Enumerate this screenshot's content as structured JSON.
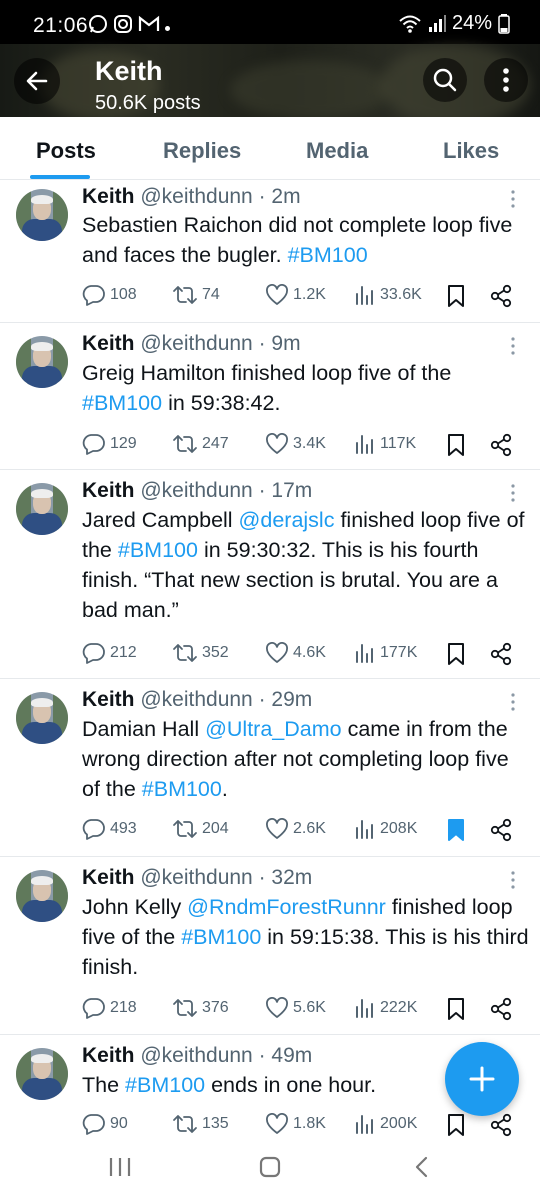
{
  "status_bar": {
    "time": "21:06",
    "battery": "24%"
  },
  "profile": {
    "name": "Keith",
    "post_count": "50.6K posts"
  },
  "tabs": [
    {
      "label": "Posts",
      "active": true
    },
    {
      "label": "Replies",
      "active": false
    },
    {
      "label": "Media",
      "active": false
    },
    {
      "label": "Likes",
      "active": false
    }
  ],
  "tweets": [
    {
      "name": "Keith",
      "handle": "@keithdunn",
      "time": "· 2m",
      "text_parts": [
        {
          "t": "Sebastien Raichon did not complete loop five and faces the bugler. "
        },
        {
          "t": "#BM100",
          "link": true
        }
      ],
      "replies": "108",
      "reposts": "74",
      "likes": "1.2K",
      "views": "33.6K",
      "bookmarked": false
    },
    {
      "name": "Keith",
      "handle": "@keithdunn",
      "time": "· 9m",
      "text_parts": [
        {
          "t": "Greig Hamilton finished loop five of the "
        },
        {
          "t": "#BM100",
          "link": true
        },
        {
          "t": " in 59:38:42."
        }
      ],
      "replies": "129",
      "reposts": "247",
      "likes": "3.4K",
      "views": "117K",
      "bookmarked": false
    },
    {
      "name": "Keith",
      "handle": "@keithdunn",
      "time": "· 17m",
      "text_parts": [
        {
          "t": "Jared Campbell "
        },
        {
          "t": "@derajslc",
          "link": true
        },
        {
          "t": " finished loop five of the "
        },
        {
          "t": "#BM100",
          "link": true
        },
        {
          "t": " in 59:30:32. This is his fourth finish. “That new section is brutal. You are a bad man.”"
        }
      ],
      "replies": "212",
      "reposts": "352",
      "likes": "4.6K",
      "views": "177K",
      "bookmarked": false
    },
    {
      "name": "Keith",
      "handle": "@keithdunn",
      "time": "· 29m",
      "text_parts": [
        {
          "t": "Damian Hall "
        },
        {
          "t": "@Ultra_Damo",
          "link": true
        },
        {
          "t": " came in from the wrong direction after not completing loop five of the "
        },
        {
          "t": "#BM100",
          "link": true
        },
        {
          "t": "."
        }
      ],
      "replies": "493",
      "reposts": "204",
      "likes": "2.6K",
      "views": "208K",
      "bookmarked": true
    },
    {
      "name": "Keith",
      "handle": "@keithdunn",
      "time": "· 32m",
      "text_parts": [
        {
          "t": "John Kelly "
        },
        {
          "t": "@RndmForestRunnr",
          "link": true
        },
        {
          "t": " finished loop five of the "
        },
        {
          "t": "#BM100",
          "link": true
        },
        {
          "t": " in 59:15:38.  This is his third finish."
        }
      ],
      "replies": "218",
      "reposts": "376",
      "likes": "5.6K",
      "views": "222K",
      "bookmarked": false
    },
    {
      "name": "Keith",
      "handle": "@keithdunn",
      "time": "· 49m",
      "text_parts": [
        {
          "t": "The "
        },
        {
          "t": "#BM100",
          "link": true
        },
        {
          "t": " ends in one hour."
        }
      ],
      "replies": "90",
      "reposts": "135",
      "likes": "1.8K",
      "views": "200K",
      "bookmarked": false
    }
  ],
  "colors": {
    "accent": "#1d9bf0",
    "text": "#0f1419",
    "muted": "#536471"
  }
}
